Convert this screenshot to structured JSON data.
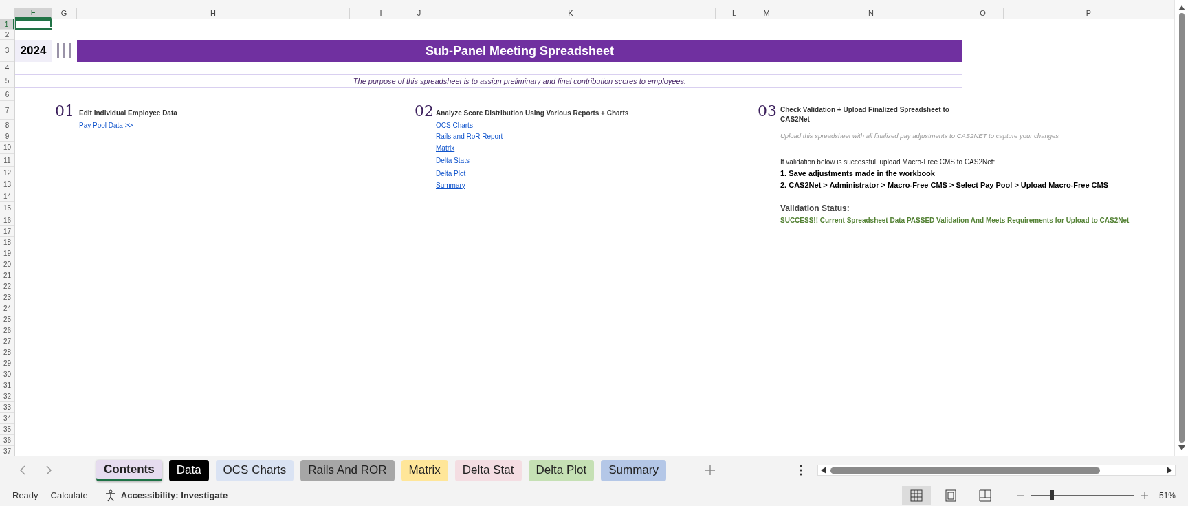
{
  "column_headers": [
    {
      "label": "F",
      "selected": true
    },
    {
      "label": "G",
      "selected": false
    },
    {
      "label": "H",
      "selected": false
    },
    {
      "label": "I",
      "selected": false
    },
    {
      "label": "J",
      "selected": false
    },
    {
      "label": "K",
      "selected": false
    },
    {
      "label": "L",
      "selected": false
    },
    {
      "label": "M",
      "selected": false
    },
    {
      "label": "N",
      "selected": false
    },
    {
      "label": "O",
      "selected": false
    },
    {
      "label": "P",
      "selected": false
    }
  ],
  "row_headers": [
    {
      "label": "1",
      "selected": true
    },
    {
      "label": "2",
      "selected": false
    },
    {
      "label": "3",
      "selected": false
    },
    {
      "label": "4",
      "selected": false
    },
    {
      "label": "5",
      "selected": false
    },
    {
      "label": "6",
      "selected": false
    },
    {
      "label": "7",
      "selected": false
    },
    {
      "label": "8",
      "selected": false
    },
    {
      "label": "9",
      "selected": false
    },
    {
      "label": "10",
      "selected": false
    },
    {
      "label": "11",
      "selected": false
    },
    {
      "label": "12",
      "selected": false
    },
    {
      "label": "13",
      "selected": false
    },
    {
      "label": "14",
      "selected": false
    },
    {
      "label": "15",
      "selected": false
    },
    {
      "label": "16",
      "selected": false
    },
    {
      "label": "17",
      "selected": false
    },
    {
      "label": "18",
      "selected": false
    },
    {
      "label": "19",
      "selected": false
    },
    {
      "label": "20",
      "selected": false
    },
    {
      "label": "21",
      "selected": false
    },
    {
      "label": "22",
      "selected": false
    },
    {
      "label": "23",
      "selected": false
    },
    {
      "label": "24",
      "selected": false
    },
    {
      "label": "25",
      "selected": false
    },
    {
      "label": "26",
      "selected": false
    },
    {
      "label": "27",
      "selected": false
    },
    {
      "label": "28",
      "selected": false
    },
    {
      "label": "29",
      "selected": false
    },
    {
      "label": "30",
      "selected": false
    },
    {
      "label": "31",
      "selected": false
    },
    {
      "label": "32",
      "selected": false
    },
    {
      "label": "33",
      "selected": false
    },
    {
      "label": "34",
      "selected": false
    },
    {
      "label": "35",
      "selected": false
    },
    {
      "label": "36",
      "selected": false
    },
    {
      "label": "37",
      "selected": false
    }
  ],
  "year": "2024",
  "banner_title": "Sub-Panel Meeting Spreadsheet",
  "purpose": "The purpose of this spreadsheet is to assign preliminary and final contribution scores to employees.",
  "sections": [
    {
      "number": "01",
      "title": "Edit Individual Employee Data",
      "links": [
        "Pay Pool Data >>"
      ]
    },
    {
      "number": "02",
      "title": "Analyze Score Distribution Using Various Reports + Charts",
      "links": [
        "OCS Charts",
        "Rails and RoR Report",
        "Matrix",
        "Delta Stats",
        "Delta Plot",
        "Summary "
      ]
    },
    {
      "number": "03",
      "title": "Check Validation + Upload Finalized Spreadsheet to CAS2Net",
      "subtitle": "Upload this spreadsheet with all finalized pay adjustments to CAS2NET to capture your changes",
      "instructions": "If validation below is successful, upload Macro-Free CMS to CAS2Net:",
      "steps": [
        "1. Save adjustments made in the workbook",
        "2. CAS2Net > Administrator > Macro-Free CMS > Select Pay Pool > Upload Macro-Free CMS"
      ],
      "validation_label": "Validation Status:",
      "validation_result": "SUCCESS!! Current Spreadsheet Data PASSED Validation And Meets Requirements for Upload to CAS2Net"
    }
  ],
  "sheet_tabs": [
    {
      "label": "Contents",
      "selected": true,
      "color": "#e6dcef"
    },
    {
      "label": "Data",
      "selected": false,
      "color": "#000000"
    },
    {
      "label": "OCS Charts",
      "selected": false,
      "color": "#dae3f3"
    },
    {
      "label": "Rails And ROR",
      "selected": false,
      "color": "#a6a6a6"
    },
    {
      "label": "Matrix",
      "selected": false,
      "color": "#ffe699"
    },
    {
      "label": "Delta Stat",
      "selected": false,
      "color": "#f4dde2"
    },
    {
      "label": "Delta Plot",
      "selected": false,
      "color": "#c5e0b4"
    },
    {
      "label": "Summary",
      "selected": false,
      "color": "#b4c7e7"
    }
  ],
  "status_bar": {
    "ready": "Ready",
    "calculate": "Calculate",
    "accessibility": "Accessibility: Investigate",
    "views": [
      {
        "kind": "normal",
        "selected": true
      },
      {
        "kind": "page-layout",
        "selected": false
      },
      {
        "kind": "page-break",
        "selected": false
      }
    ],
    "zoom": {
      "level": 0.2,
      "reading": "51%"
    }
  }
}
